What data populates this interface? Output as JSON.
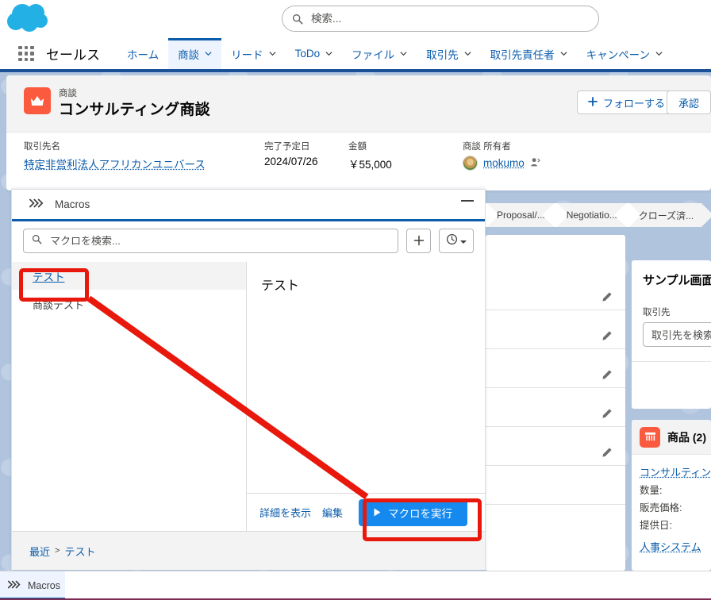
{
  "topbar": {
    "logo_icon": "salesforce-cloud-logo",
    "search": {
      "placeholder": "検索...",
      "value": "",
      "icon": "search-icon"
    }
  },
  "nav": {
    "waffle_icon": "app-launcher-icon",
    "app_name": "セールス",
    "items": [
      {
        "label": "ホーム",
        "has_menu": false,
        "active": false
      },
      {
        "label": "商談",
        "has_menu": true,
        "active": true
      },
      {
        "label": "リード",
        "has_menu": true,
        "active": false
      },
      {
        "label": "ToDo",
        "has_menu": true,
        "active": false
      },
      {
        "label": "ファイル",
        "has_menu": true,
        "active": false
      },
      {
        "label": "取引先",
        "has_menu": true,
        "active": false
      },
      {
        "label": "取引先責任者",
        "has_menu": true,
        "active": false
      },
      {
        "label": "キャンペーン",
        "has_menu": true,
        "active": false
      }
    ]
  },
  "record": {
    "object_icon": "opportunity-crown-icon",
    "object_type": "商談",
    "title": "コンサルティング商談",
    "buttons": {
      "follow": {
        "label": "フォローする",
        "icon": "plus-icon"
      },
      "approve": {
        "label": "承認"
      }
    },
    "fields": [
      {
        "label": "取引先名",
        "value": "特定非営利法人アフリカンユニバース",
        "is_link": true
      },
      {
        "label": "完了予定日",
        "value": "2024/07/26",
        "is_link": false
      },
      {
        "label": "金額",
        "value": "￥55,000",
        "is_link": false
      }
    ],
    "owner": {
      "label": "商談 所有者",
      "name": "mokumo",
      "avatar": "dog-avatar",
      "change_owner_icon": "change-owner-icon"
    }
  },
  "path": {
    "stages": [
      "Proposal/...",
      "Negotiatio...",
      "クローズ済..."
    ]
  },
  "details_panel": {
    "rows": [
      {
        "edit_icon": "pencil-icon"
      },
      {
        "edit_icon": "pencil-icon"
      },
      {
        "edit_icon": "pencil-icon"
      },
      {
        "edit_icon": "pencil-icon"
      },
      {
        "edit_icon": "pencil-icon"
      }
    ]
  },
  "sample_panel": {
    "title": "サンプル画面",
    "field_label": "取引先",
    "field_placeholder": "取引先を検索..."
  },
  "products_panel": {
    "icon": "product-icon",
    "title": "商品 (2)",
    "items": [
      {
        "name": "コンサルティングサービス",
        "attrs": [
          {
            "label": "数量:",
            "value": ""
          },
          {
            "label": "販売価格:",
            "value": ""
          },
          {
            "label": "提供日:",
            "value": ""
          }
        ]
      },
      {
        "name": "人事システム",
        "attrs": []
      }
    ]
  },
  "macros": {
    "panel_icon": "macros-chevrons-icon",
    "panel_title": "Macros",
    "minimize_icon": "minimize-icon",
    "search": {
      "placeholder": "マクロを検索...",
      "value": "",
      "icon": "search-icon"
    },
    "add_button": {
      "icon": "plus-icon"
    },
    "recent_button": {
      "icon": "clock-icon",
      "caret": "caret-down-icon"
    },
    "list": [
      {
        "name": "テスト",
        "selected": true
      },
      {
        "name": "商談テスト",
        "selected": false
      }
    ],
    "detail_title": "テスト",
    "footer": {
      "view_detail": "詳細を表示",
      "edit": "編集",
      "run": {
        "label": "マクロを実行",
        "icon": "play-icon"
      }
    },
    "breadcrumb": {
      "root": "最近",
      "separator": ">",
      "current": "テスト"
    }
  },
  "utility_bar": {
    "items": [
      {
        "label": "Macros",
        "icon": "macros-chevrons-icon",
        "active": true
      }
    ]
  },
  "annotations": {
    "highlight_color": "#e8180c",
    "boxes": [
      "macro-name-テスト",
      "run-macro-button"
    ],
    "arrow": "from-macro-name-to-run-button"
  },
  "colors": {
    "brand_blue": "#0b5cab",
    "button_blue": "#1589ee",
    "icon_orange": "#fb5a3f",
    "page_bg": "#b0c4de",
    "annotation_red": "#e8180c"
  }
}
